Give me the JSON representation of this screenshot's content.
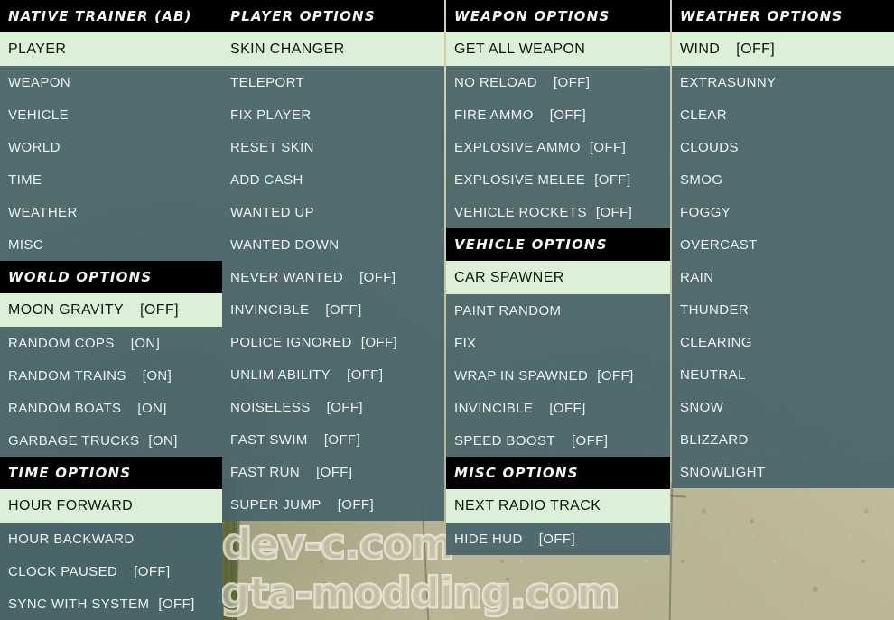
{
  "watermark": {
    "line1": "dev-c.com",
    "line2": "gta-modding.com"
  },
  "colors": {
    "selected_bg": "#dcf0d7",
    "panel_bg": "#48646a",
    "header_bg": "#000000",
    "text": "#eef3f1",
    "selected_text": "#0c1a0c"
  },
  "columns": [
    {
      "name": "column-1",
      "sections": [
        {
          "title": "NATIVE TRAINER (AB)",
          "rows": [
            {
              "label": "PLAYER",
              "value": "",
              "selected": true
            },
            {
              "label": "WEAPON",
              "value": "",
              "selected": false
            },
            {
              "label": "VEHICLE",
              "value": "",
              "selected": false
            },
            {
              "label": "WORLD",
              "value": "",
              "selected": false
            },
            {
              "label": "TIME",
              "value": "",
              "selected": false
            },
            {
              "label": "WEATHER",
              "value": "",
              "selected": false
            },
            {
              "label": "MISC",
              "value": "",
              "selected": false
            }
          ]
        },
        {
          "title": "WORLD OPTIONS",
          "rows": [
            {
              "label": "MOON GRAVITY",
              "value": "[OFF]",
              "selected": true
            },
            {
              "label": "RANDOM COPS",
              "value": "[ON]",
              "selected": false
            },
            {
              "label": "RANDOM TRAINS",
              "value": "[ON]",
              "selected": false
            },
            {
              "label": "RANDOM BOATS",
              "value": "[ON]",
              "selected": false
            },
            {
              "label": "GARBAGE TRUCKS",
              "value": "[ON]",
              "selected": false
            }
          ]
        },
        {
          "title": "TIME OPTIONS",
          "rows": [
            {
              "label": "HOUR FORWARD",
              "value": "",
              "selected": true
            },
            {
              "label": "HOUR BACKWARD",
              "value": "",
              "selected": false
            },
            {
              "label": "CLOCK PAUSED",
              "value": "[OFF]",
              "selected": false
            },
            {
              "label": "SYNC WITH SYSTEM",
              "value": "[OFF]",
              "selected": false
            }
          ]
        }
      ]
    },
    {
      "name": "column-2",
      "sections": [
        {
          "title": "PLAYER OPTIONS",
          "rows": [
            {
              "label": "SKIN CHANGER",
              "value": "",
              "selected": true
            },
            {
              "label": "TELEPORT",
              "value": "",
              "selected": false
            },
            {
              "label": "FIX PLAYER",
              "value": "",
              "selected": false
            },
            {
              "label": "RESET SKIN",
              "value": "",
              "selected": false
            },
            {
              "label": "ADD CASH",
              "value": "",
              "selected": false
            },
            {
              "label": "WANTED UP",
              "value": "",
              "selected": false
            },
            {
              "label": "WANTED DOWN",
              "value": "",
              "selected": false
            },
            {
              "label": "NEVER WANTED",
              "value": "[OFF]",
              "selected": false
            },
            {
              "label": "INVINCIBLE",
              "value": "[OFF]",
              "selected": false
            },
            {
              "label": "POLICE IGNORED",
              "value": "[OFF]",
              "selected": false
            },
            {
              "label": "UNLIM ABILITY",
              "value": "[OFF]",
              "selected": false
            },
            {
              "label": "NOISELESS",
              "value": "[OFF]",
              "selected": false
            },
            {
              "label": "FAST SWIM",
              "value": "[OFF]",
              "selected": false
            },
            {
              "label": "FAST RUN",
              "value": "[OFF]",
              "selected": false
            },
            {
              "label": "SUPER JUMP",
              "value": "[OFF]",
              "selected": false
            }
          ]
        }
      ]
    },
    {
      "name": "column-3",
      "sections": [
        {
          "title": "WEAPON OPTIONS",
          "rows": [
            {
              "label": "GET ALL WEAPON",
              "value": "",
              "selected": true
            },
            {
              "label": "NO RELOAD",
              "value": "[OFF]",
              "selected": false
            },
            {
              "label": "FIRE AMMO",
              "value": "[OFF]",
              "selected": false
            },
            {
              "label": "EXPLOSIVE AMMO",
              "value": "[OFF]",
              "selected": false
            },
            {
              "label": "EXPLOSIVE MELEE",
              "value": "[OFF]",
              "selected": false
            },
            {
              "label": "VEHICLE ROCKETS",
              "value": "[OFF]",
              "selected": false
            }
          ]
        },
        {
          "title": "VEHICLE OPTIONS",
          "rows": [
            {
              "label": "CAR SPAWNER",
              "value": "",
              "selected": true
            },
            {
              "label": "PAINT RANDOM",
              "value": "",
              "selected": false
            },
            {
              "label": "FIX",
              "value": "",
              "selected": false
            },
            {
              "label": "WRAP IN SPAWNED",
              "value": "[OFF]",
              "selected": false
            },
            {
              "label": "INVINCIBLE",
              "value": "[OFF]",
              "selected": false
            },
            {
              "label": "SPEED BOOST",
              "value": "[OFF]",
              "selected": false
            }
          ]
        },
        {
          "title": "MISC OPTIONS",
          "rows": [
            {
              "label": "NEXT RADIO TRACK",
              "value": "",
              "selected": true
            },
            {
              "label": "HIDE HUD",
              "value": "[OFF]",
              "selected": false
            }
          ]
        }
      ]
    },
    {
      "name": "column-4",
      "sections": [
        {
          "title": "WEATHER OPTIONS",
          "rows": [
            {
              "label": "WIND",
              "value": "[OFF]",
              "selected": true
            },
            {
              "label": "EXTRASUNNY",
              "value": "",
              "selected": false
            },
            {
              "label": "CLEAR",
              "value": "",
              "selected": false
            },
            {
              "label": "CLOUDS",
              "value": "",
              "selected": false
            },
            {
              "label": "SMOG",
              "value": "",
              "selected": false
            },
            {
              "label": "FOGGY",
              "value": "",
              "selected": false
            },
            {
              "label": "OVERCAST",
              "value": "",
              "selected": false
            },
            {
              "label": "RAIN",
              "value": "",
              "selected": false
            },
            {
              "label": "THUNDER",
              "value": "",
              "selected": false
            },
            {
              "label": "CLEARING",
              "value": "",
              "selected": false
            },
            {
              "label": "NEUTRAL",
              "value": "",
              "selected": false
            },
            {
              "label": "SNOW",
              "value": "",
              "selected": false
            },
            {
              "label": "BLIZZARD",
              "value": "",
              "selected": false
            },
            {
              "label": "SNOWLIGHT",
              "value": "",
              "selected": false
            }
          ]
        }
      ]
    }
  ]
}
